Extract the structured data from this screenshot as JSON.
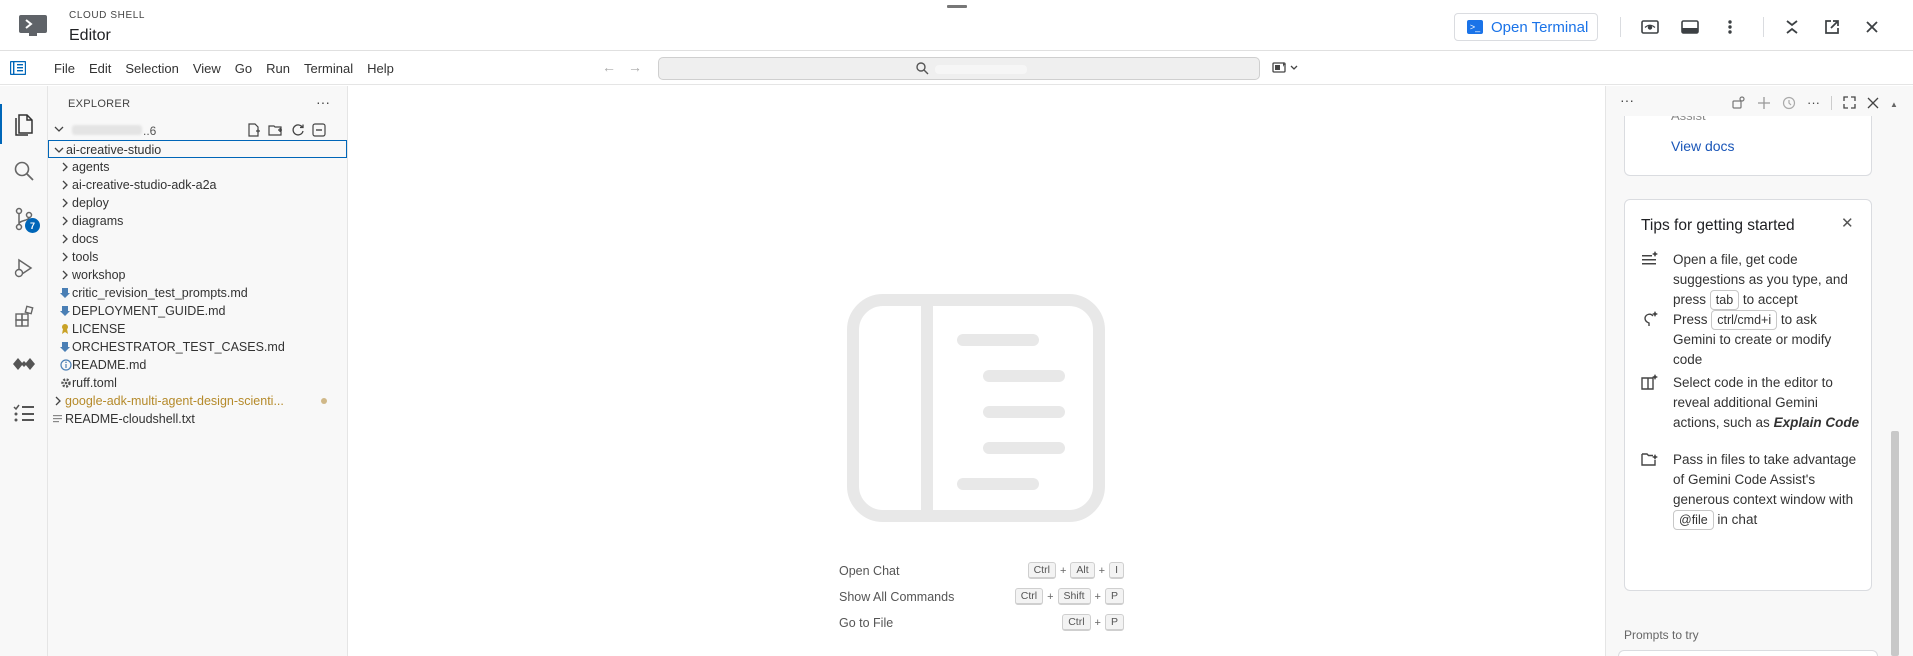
{
  "app": {
    "subtitle": "CLOUD SHELL",
    "title": "Editor",
    "open_terminal_label": "Open Terminal"
  },
  "menu": [
    "File",
    "Edit",
    "Selection",
    "View",
    "Go",
    "Run",
    "Terminal",
    "Help"
  ],
  "activity": {
    "source_control_badge": "7"
  },
  "explorer": {
    "title": "EXPLORER",
    "workspace_suffix": "..6",
    "tree": [
      {
        "label": "ai-creative-studio",
        "kind": "folder-open",
        "depth": 1,
        "selected": true
      },
      {
        "label": "agents",
        "kind": "folder",
        "depth": 2
      },
      {
        "label": "ai-creative-studio-adk-a2a",
        "kind": "folder",
        "depth": 2
      },
      {
        "label": "deploy",
        "kind": "folder",
        "depth": 2
      },
      {
        "label": "diagrams",
        "kind": "folder",
        "depth": 2
      },
      {
        "label": "docs",
        "kind": "folder",
        "depth": 2
      },
      {
        "label": "tools",
        "kind": "folder",
        "depth": 2
      },
      {
        "label": "workshop",
        "kind": "folder",
        "depth": 2
      },
      {
        "label": "critic_revision_test_prompts.md",
        "kind": "md",
        "depth": 2
      },
      {
        "label": "DEPLOYMENT_GUIDE.md",
        "kind": "md",
        "depth": 2
      },
      {
        "label": "LICENSE",
        "kind": "license",
        "depth": 2
      },
      {
        "label": "ORCHESTRATOR_TEST_CASES.md",
        "kind": "md",
        "depth": 2
      },
      {
        "label": "README.md",
        "kind": "info",
        "depth": 2
      },
      {
        "label": "ruff.toml",
        "kind": "gear",
        "depth": 2
      },
      {
        "label": "google-adk-multi-agent-design-scienti...",
        "kind": "folder-mod",
        "depth": 1
      },
      {
        "label": "README-cloudshell.txt",
        "kind": "txt",
        "depth": 1
      }
    ]
  },
  "shortcuts": [
    {
      "name": "Open Chat",
      "keys": [
        "Ctrl",
        "Alt",
        "I"
      ]
    },
    {
      "name": "Show All Commands",
      "keys": [
        "Ctrl",
        "Shift",
        "P"
      ]
    },
    {
      "name": "Go to File",
      "keys": [
        "Ctrl",
        "P"
      ]
    }
  ],
  "gemini": {
    "cut_text": "Assist",
    "view_docs": "View docs",
    "tips_title": "Tips for getting started",
    "tips": [
      {
        "icon": "sparkle-lines-icon",
        "parts": [
          "Open a file, get code suggestions as you type, and press ",
          "tab",
          " to accept"
        ]
      },
      {
        "icon": "bulb-sparkle-icon",
        "parts": [
          "Press ",
          "ctrl/cmd+i",
          " to ask Gemini to create or modify code"
        ]
      },
      {
        "icon": "book-sparkle-icon",
        "parts": [
          "Select code in the editor to reveal additional Gemini actions, such as ",
          "Explain Code",
          ""
        ]
      },
      {
        "icon": "folder-sparkle-icon",
        "parts": [
          "Pass in files to take advantage of Gemini Code Assist's generous context window with ",
          "@file",
          " in chat"
        ]
      }
    ],
    "prompts_label": "Prompts to try"
  }
}
